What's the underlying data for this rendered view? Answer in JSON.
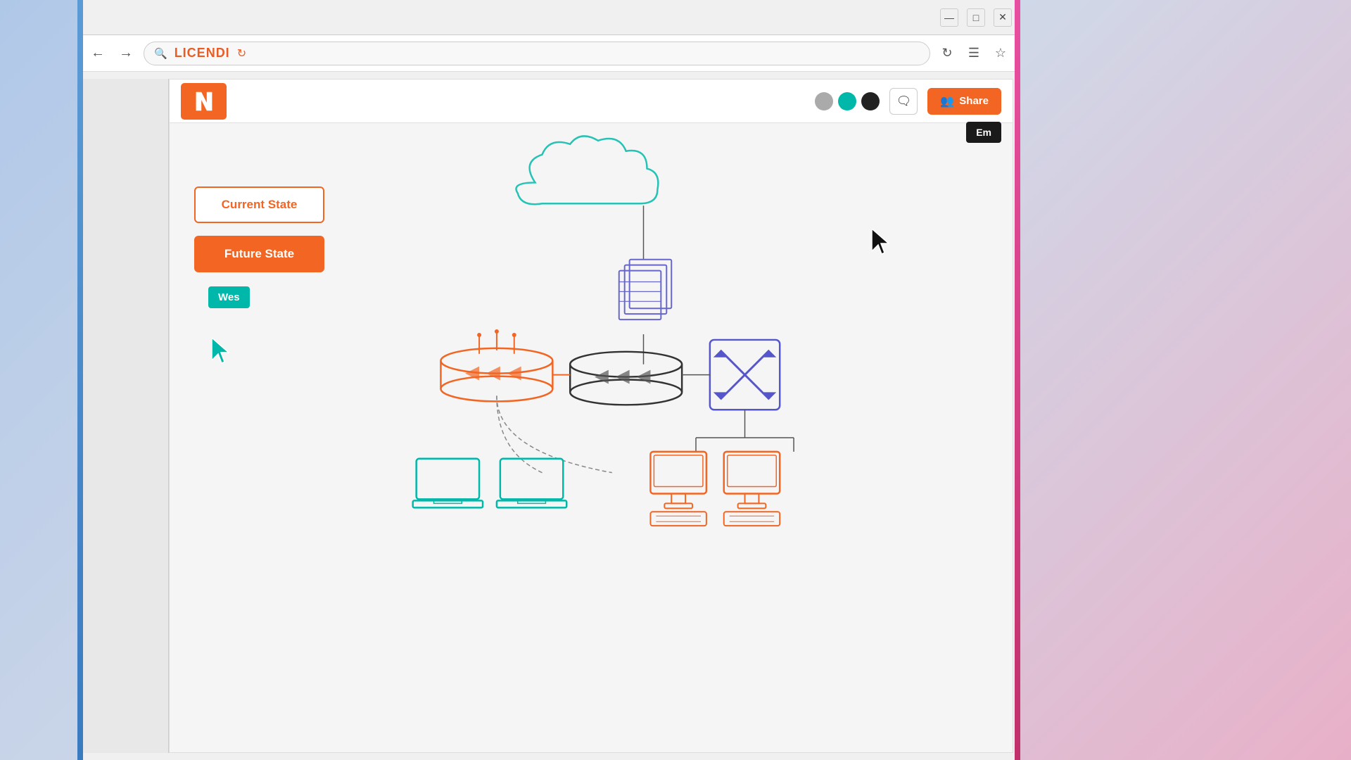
{
  "browser": {
    "title_bar": {
      "minimize_label": "—",
      "maximize_label": "□",
      "close_label": "✕"
    },
    "nav": {
      "back_label": "←",
      "forward_label": "→",
      "reload_label": "↻",
      "menu_label": "☰",
      "bookmark_label": "☆",
      "brand": "LICENDI ⟳"
    }
  },
  "toolbar": {
    "share_label": "Share",
    "comment_icon": "💬",
    "em_tooltip": "Em",
    "color_dots": [
      {
        "color": "#aaaaaa"
      },
      {
        "color": "#00b8a9"
      },
      {
        "color": "#222222"
      }
    ]
  },
  "diagram": {
    "current_state_label": "Current State",
    "future_state_label": "Future State",
    "wes_label": "Wes"
  }
}
